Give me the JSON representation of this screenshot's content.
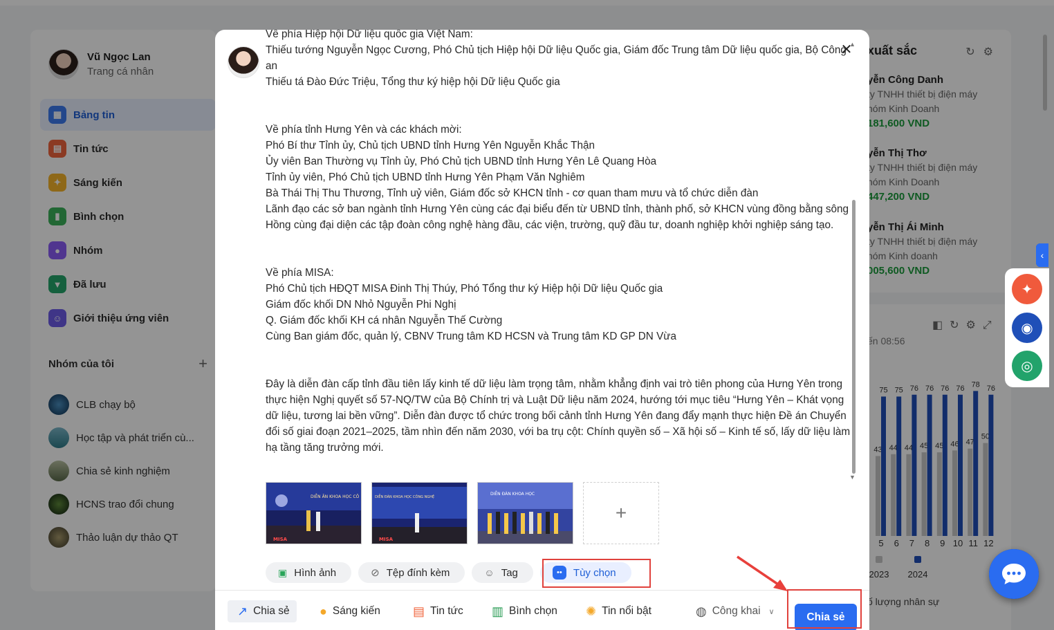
{
  "user": {
    "name": "Vũ Ngọc Lan",
    "subtitle": "Trang cá nhân"
  },
  "menu": [
    {
      "label": "Bảng tin",
      "icon": "newsfeed-icon",
      "color": "#3d7af0",
      "active": true
    },
    {
      "label": "Tin tức",
      "icon": "news-icon",
      "color": "#f0653d"
    },
    {
      "label": "Sáng kiến",
      "icon": "lightbulb-icon",
      "color": "#f4b42a"
    },
    {
      "label": "Bình chọn",
      "icon": "poll-icon",
      "color": "#3bb15a"
    },
    {
      "label": "Nhóm",
      "icon": "group-icon",
      "color": "#8b5cf6"
    },
    {
      "label": "Đã lưu",
      "icon": "bookmark-icon",
      "color": "#25a66b"
    },
    {
      "label": "Giới thiệu ứng viên",
      "icon": "referral-icon",
      "color": "#6d5ce8"
    }
  ],
  "groups": {
    "title": "Nhóm của tôi",
    "add_icon": "plus-icon",
    "items": [
      {
        "label": "CLB chạy bộ"
      },
      {
        "label": "Học tập và phát triển cù..."
      },
      {
        "label": "Chia sẻ kinh nghiệm"
      },
      {
        "label": "HCNS trao đổi chung"
      },
      {
        "label": "Thảo luận dự thảo QT"
      }
    ]
  },
  "leaderboard": {
    "title": "xuất sắc",
    "people": [
      {
        "name": "yễn Công Danh",
        "company": "ty TNHH thiết bị điện máy",
        "team": "hóm Kinh Doanh",
        "value": "181,600 VND"
      },
      {
        "name": "yễn Thị Thơ",
        "company": "ty TNHH thiết bị điện máy",
        "team": "hóm Kinh Doanh",
        "value": "447,200 VND"
      },
      {
        "name": "yễn Thị Ái Minh",
        "company": "ty TNHH thiết bị điện máy",
        "team": "hóm Kinh doanh",
        "value": "005,600 VND"
      }
    ]
  },
  "chart_panel": {
    "updated": "ến 08:56",
    "footer": "ố lượng nhân sự"
  },
  "chart_data": {
    "type": "bar",
    "categories": [
      "5",
      "6",
      "7",
      "8",
      "9",
      "10",
      "11",
      "12"
    ],
    "series": [
      {
        "name": "2023",
        "values": [
          43,
          44,
          44,
          45,
          45,
          46,
          47,
          50
        ],
        "color": "#c9c9c9"
      },
      {
        "name": "2024",
        "values": [
          75,
          75,
          76,
          76,
          76,
          76,
          78,
          76
        ],
        "color": "#1f4fb8"
      }
    ],
    "ylim": [
      0,
      80
    ],
    "legend": "bottom"
  },
  "post": {
    "lines": [
      "Về phía Hiệp hội Dữ liệu quốc gia Việt Nam:",
      "Thiếu tướng Nguyễn Ngọc Cương, Phó Chủ tịch Hiệp hội Dữ liệu Quốc gia, Giám đốc Trung tâm Dữ liệu quốc gia, Bộ Công an",
      "Thiếu tá Đào Đức Triệu, Tổng thư ký hiệp hội Dữ liệu Quốc gia",
      "",
      "",
      "Về phía tỉnh Hưng Yên và các khách mời:",
      "Phó Bí thư Tỉnh ủy, Chủ tịch UBND tỉnh Hưng Yên Nguyễn Khắc Thận",
      "Ủy viên Ban Thường vụ Tỉnh ủy, Phó Chủ tịch UBND tỉnh Hưng Yên Lê Quang Hòa",
      "Tỉnh ủy viên, Phó Chủ tịch UBND tỉnh Hưng Yên Phạm Văn Nghiêm",
      "Bà Thái Thị Thu Thương, Tỉnh uỷ viên, Giám đốc sở KHCN tỉnh - cơ quan tham mưu và tổ chức diễn đàn",
      "Lãnh đạo các sở ban ngành tỉnh Hưng Yên cùng các đại biểu đến từ UBND tỉnh, thành phố, sở KHCN vùng đồng bằng sông Hồng cùng đại diện các tập đoàn công nghệ hàng đầu, các viện, trường, quỹ đầu tư, doanh nghiệp khởi nghiệp sáng tạo.",
      "",
      "",
      "Về phía MISA:",
      "Phó Chủ tịch HĐQT MISA Đinh Thị Thúy, Phó Tổng thư ký Hiệp hội Dữ liệu Quốc gia",
      "Giám đốc khối DN Nhỏ Nguyễn Phi Nghị",
      "Q. Giám đốc khối KH cá nhân Nguyễn Thế Cường",
      "Cùng Ban giám đốc, quản lý, CBNV Trung tâm KD HCSN và Trung tâm KD GP DN Vừa",
      "",
      "",
      "Đây là diễn đàn cấp tỉnh đầu tiên lấy kinh tế dữ liệu làm trọng tâm, nhằm khẳng định vai trò tiên phong của Hưng Yên trong thực hiện Nghị quyết số 57-NQ/TW của Bộ Chính trị và Luật Dữ liệu năm 2024, hướng tới mục tiêu “Hưng Yên – Khát vọng dữ liệu, tương lai bền vững”. Diễn đàn được tổ chức trong bối cảnh tỉnh Hưng Yên đang đẩy mạnh thực hiện Đề án Chuyển đổi số giai đoạn 2021–2025, tầm nhìn đến năm 2030, với ba trụ cột: Chính quyền số – Xã hội số – Kinh tế số, lấy dữ liệu làm hạ tầng tăng trưởng mới."
    ],
    "images": [
      {
        "name": "event-photo-1",
        "banner": "DIỄN ĀN KHOA HỌC CÔ",
        "logo": "MISA"
      },
      {
        "name": "event-photo-2",
        "banner": "DIỄN ĐÀN KHOA HỌC CÔNG NGHỆ",
        "logo": "MISA"
      },
      {
        "name": "event-photo-3",
        "banner": "DIỄN ĐÀN KHOA HỌC",
        "logo": ""
      }
    ],
    "add_image": "+"
  },
  "attach": {
    "image": "Hình ảnh",
    "file": "Tệp đính kèm",
    "tag": "Tag",
    "options": "Tùy chọn"
  },
  "bottom": {
    "share_type": "Chia sẻ",
    "initiative": "Sáng kiến",
    "news": "Tin tức",
    "poll": "Bình chọn",
    "featured": "Tin nổi bật",
    "privacy": "Công khai",
    "submit": "Chia sẻ"
  },
  "colors": {
    "primary": "#2a6cf0",
    "highlight": "#e0413c"
  }
}
